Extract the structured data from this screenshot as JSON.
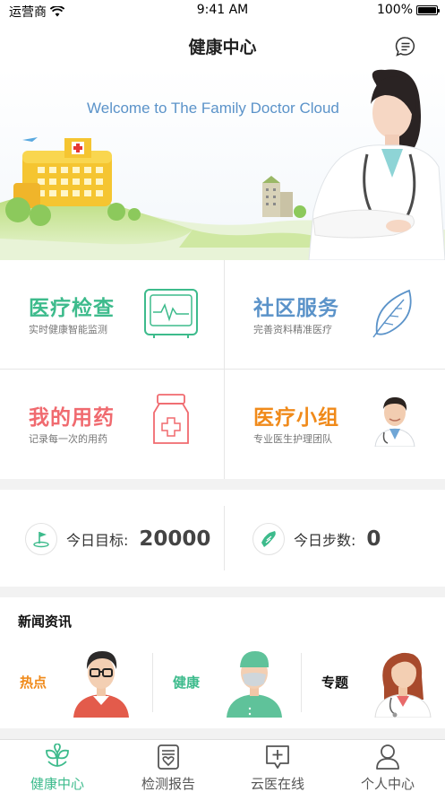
{
  "status_bar": {
    "carrier": "运营商",
    "time": "9:41 AM",
    "battery": "100%"
  },
  "nav": {
    "title": "健康中心"
  },
  "banner": {
    "welcome": "Welcome to The Family Doctor Cloud"
  },
  "services": [
    {
      "title": "医疗检查",
      "subtitle": "实时健康智能监测",
      "color": "#3dbb8c",
      "icon": "monitor-icon"
    },
    {
      "title": "社区服务",
      "subtitle": "完善资料精准医疗",
      "color": "#5b93c9",
      "icon": "leaf-icon"
    },
    {
      "title": "我的用药",
      "subtitle": "记录每一次的用药",
      "color": "#f06a6f",
      "icon": "medicine-bottle-icon"
    },
    {
      "title": "医疗小组",
      "subtitle": "专业医生护理团队",
      "color": "#f08a1a",
      "icon": "doctor-avatar"
    }
  ],
  "steps": {
    "goal_label": "今日目标:",
    "goal_value": "20000",
    "count_label": "今日步数:",
    "count_value": "0"
  },
  "news": {
    "header": "新闻资讯",
    "tiles": [
      {
        "label": "热点",
        "color": "#f08a1a"
      },
      {
        "label": "健康",
        "color": "#3dbb8c"
      },
      {
        "label": "专题",
        "color": "#111111"
      }
    ]
  },
  "tabs": [
    {
      "label": "健康中心",
      "icon": "sprout-icon",
      "active": true
    },
    {
      "label": "检测报告",
      "icon": "report-icon",
      "active": false
    },
    {
      "label": "云医在线",
      "icon": "plus-chat-icon",
      "active": false
    },
    {
      "label": "个人中心",
      "icon": "person-icon",
      "active": false
    }
  ]
}
